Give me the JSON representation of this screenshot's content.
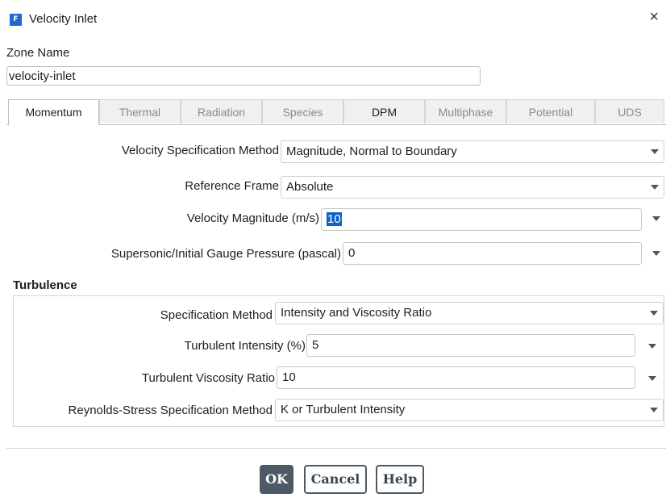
{
  "window": {
    "title": "Velocity Inlet",
    "app_icon_letter": "F",
    "close_glyph": "×"
  },
  "zone": {
    "label": "Zone Name",
    "value": "velocity-inlet"
  },
  "tabs": [
    {
      "label": "Momentum",
      "state": "active"
    },
    {
      "label": "Thermal",
      "state": "disabled"
    },
    {
      "label": "Radiation",
      "state": "disabled"
    },
    {
      "label": "Species",
      "state": "disabled"
    },
    {
      "label": "DPM",
      "state": "enabled"
    },
    {
      "label": "Multiphase",
      "state": "disabled"
    },
    {
      "label": "Potential",
      "state": "disabled"
    },
    {
      "label": "UDS",
      "state": "disabled"
    }
  ],
  "momentum": {
    "velocity_spec": {
      "label": "Velocity Specification Method",
      "value": "Magnitude, Normal to Boundary"
    },
    "reference_frame": {
      "label": "Reference Frame",
      "value": "Absolute"
    },
    "velocity_magnitude": {
      "label": "Velocity Magnitude (m/s)",
      "value": "10"
    },
    "gauge_pressure": {
      "label": "Supersonic/Initial Gauge Pressure (pascal)",
      "value": "0"
    }
  },
  "turbulence": {
    "title": "Turbulence",
    "spec_method": {
      "label": "Specification Method",
      "value": "Intensity and Viscosity Ratio"
    },
    "intensity": {
      "label": "Turbulent Intensity (%)",
      "value": "5"
    },
    "viscosity_ratio": {
      "label": "Turbulent Viscosity Ratio",
      "value": "10"
    },
    "reynolds": {
      "label": "Reynolds-Stress Specification Method",
      "value": "K or Turbulent Intensity"
    }
  },
  "buttons": {
    "ok": "OK",
    "cancel": "Cancel",
    "help": "Help"
  },
  "colors": {
    "accent": "#1f67d2",
    "selection": "#0b63c7",
    "button": "#4d5a66"
  }
}
